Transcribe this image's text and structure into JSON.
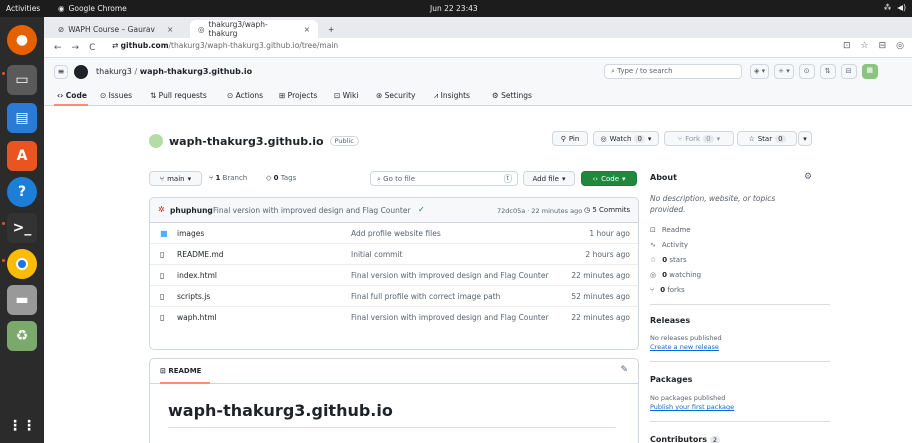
{
  "os": {
    "activities": "Activities",
    "app_name": "Google Chrome",
    "clock": "Jun 22  23:43"
  },
  "browser": {
    "tabs": [
      {
        "label": "WAPH Course – Gaurav",
        "active": false
      },
      {
        "label": "thakurg3/waph-thakurg",
        "active": true
      }
    ],
    "url_host": "github.com",
    "url_path": "/thakurg3/waph-thakurg3.github.io/tree/main"
  },
  "header": {
    "owner": "thakurg3",
    "separator": "/",
    "repo": "waph-thakurg3.github.io",
    "search_placeholder": "Type / to search"
  },
  "repo_nav": {
    "items": [
      "Code",
      "Issues",
      "Pull requests",
      "Actions",
      "Projects",
      "Wiki",
      "Security",
      "Insights",
      "Settings"
    ]
  },
  "repo": {
    "title": "waph-thakurg3.github.io",
    "visibility": "Public",
    "pin": "Pin",
    "watch": "Watch",
    "watch_count": "0",
    "fork": "Fork",
    "fork_count": "0",
    "star": "Star",
    "star_count": "0"
  },
  "toolbar": {
    "branch": "main",
    "branches": "1",
    "branch_label": "Branch",
    "tags": "0",
    "tags_label": "Tags",
    "goto": "Go to file",
    "goto_key": "t",
    "add_file": "Add file",
    "code": "Code"
  },
  "commit": {
    "author": "phuphung",
    "message": "Final version with improved design and Flag Counter",
    "hash": "72dc05a · 22 minutes ago",
    "count": "5 Commits"
  },
  "files": [
    {
      "type": "dir",
      "name": "images",
      "message": "Add profile website files",
      "date": "1 hour ago"
    },
    {
      "type": "file",
      "name": "README.md",
      "message": "Initial commit",
      "date": "2 hours ago"
    },
    {
      "type": "file",
      "name": "index.html",
      "message": "Final version with improved design and Flag Counter",
      "date": "22 minutes ago"
    },
    {
      "type": "file",
      "name": "scripts.js",
      "message": "Final full profile with correct image path",
      "date": "52 minutes ago"
    },
    {
      "type": "file",
      "name": "waph.html",
      "message": "Final version with improved design and Flag Counter",
      "date": "22 minutes ago"
    }
  ],
  "readme": {
    "tab": "README",
    "heading": "waph-thakurg3.github.io"
  },
  "about": {
    "title": "About",
    "description": "No description, website, or topics provided.",
    "readme": "Readme",
    "activity": "Activity",
    "stars": "0",
    "stars_label": "stars",
    "watching": "0",
    "watching_label": "watching",
    "forks": "0",
    "forks_label": "forks"
  },
  "releases": {
    "title": "Releases",
    "none": "No releases published",
    "create": "Create a new release"
  },
  "packages": {
    "title": "Packages",
    "none": "No packages published",
    "publish": "Publish your first package"
  },
  "contributors": {
    "title": "Contributors",
    "count": "2"
  }
}
